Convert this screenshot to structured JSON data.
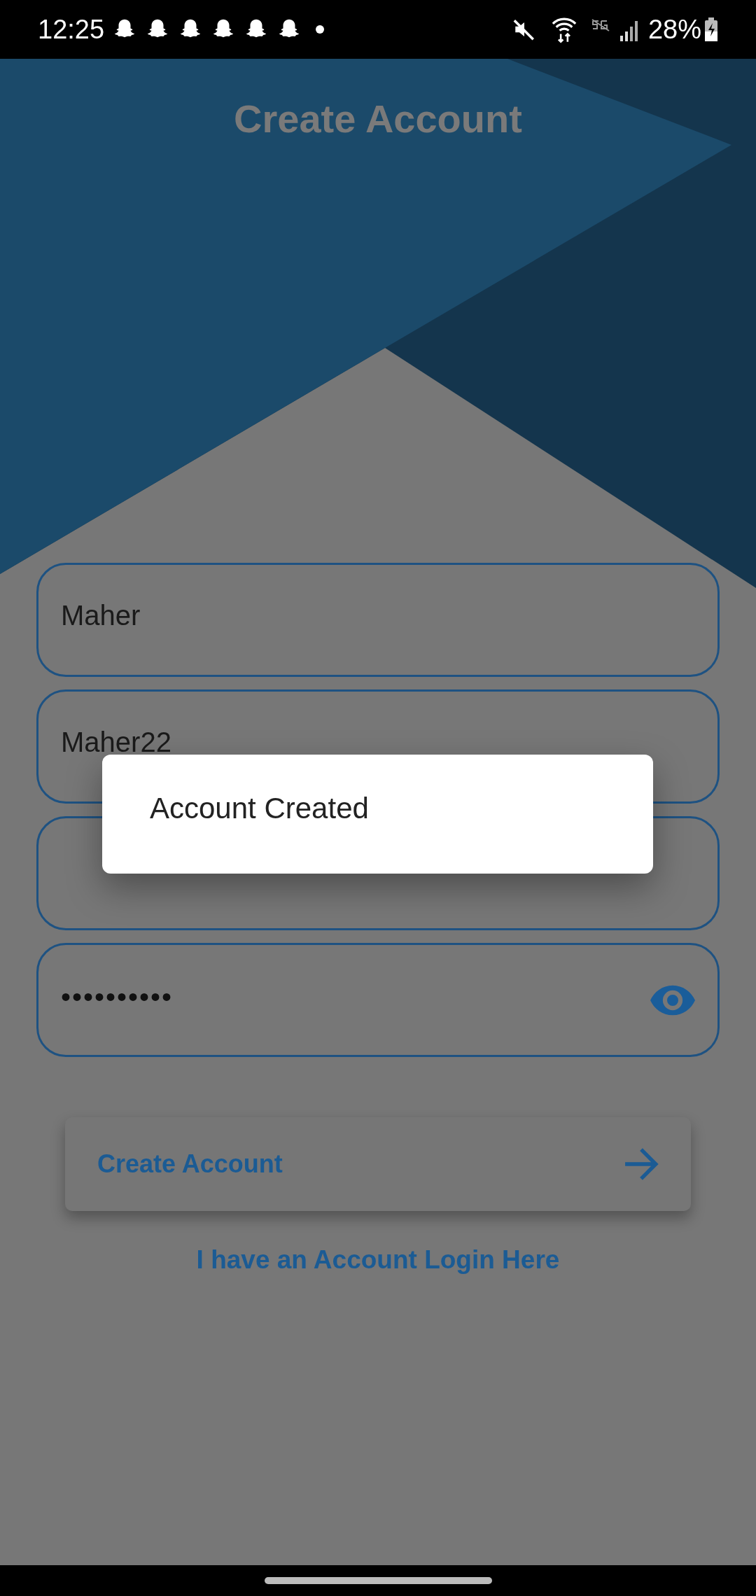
{
  "status_bar": {
    "time": "12:25",
    "battery": "28%"
  },
  "title": "Create Account",
  "fields": [
    {
      "kind": "text",
      "value": "Maher"
    },
    {
      "kind": "text",
      "value": "Maher22"
    },
    {
      "kind": "text"
    },
    {
      "kind": "password",
      "value": "••••••••••"
    }
  ],
  "button": {
    "label": "Create Account"
  },
  "link": "I have an Account Login Here",
  "dialog": {
    "message": "Account Created"
  }
}
